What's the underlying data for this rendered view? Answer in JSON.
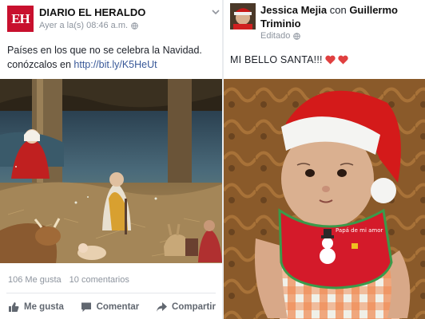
{
  "left_post": {
    "logo_text": "EH",
    "author": "DIARIO EL HERALDO",
    "timestamp": "Ayer a la(s) 08:46 a.m.",
    "text": "Países en los que no se celebra la Navidad. conózcalos en ",
    "link": "http://bit.ly/K5HeUt",
    "likes": "106 Me gusta",
    "comments": "10 comentarios",
    "actions": {
      "like": "Me gusta",
      "comment": "Comentar",
      "share": "Compartir"
    }
  },
  "right_post": {
    "author": "Jessica Mejia",
    "connector": " con ",
    "tagged": "Guillermo Triminio",
    "meta": "Editado",
    "text": "MI BELLO SANTA!!!",
    "bib_text": "Papá de mi amor"
  },
  "colors": {
    "brand_red": "#c8102e",
    "link_blue": "#385898",
    "meta_gray": "#8d949e"
  }
}
